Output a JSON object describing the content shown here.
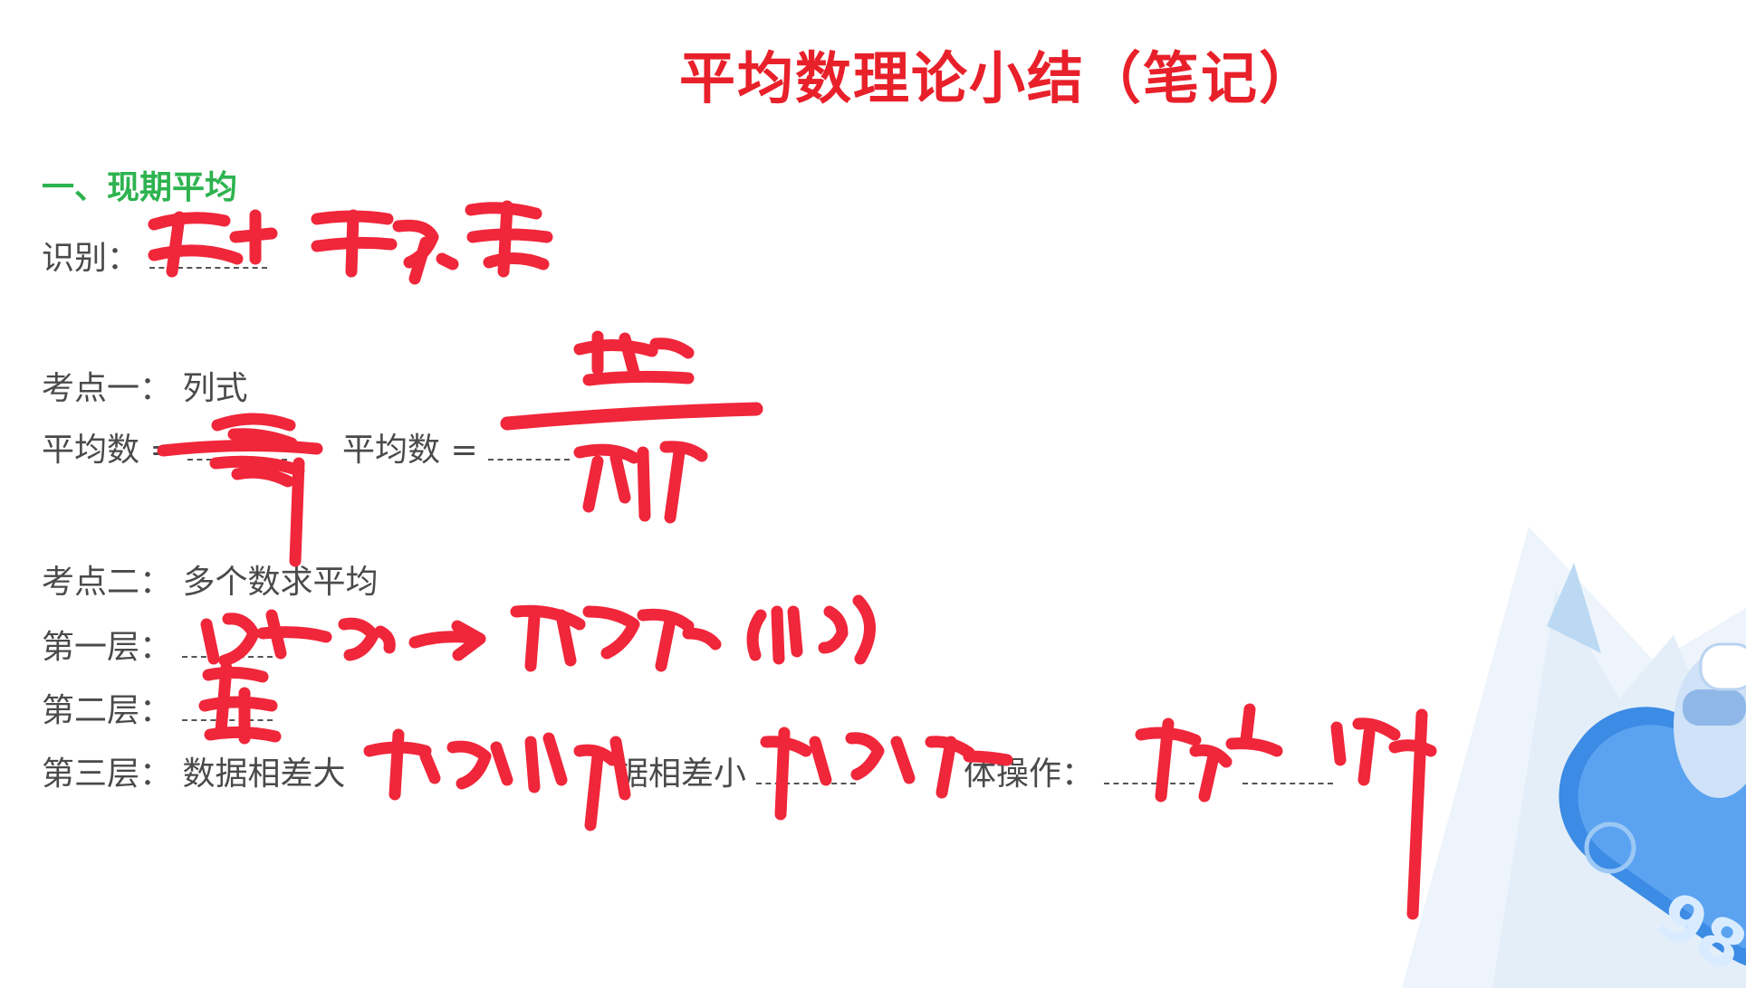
{
  "title": "平均数理论小结（笔记）",
  "section1": "一、现期平均",
  "identify_label": "识别：",
  "point1": "考点一：  列式",
  "avg_label_1": "平均数 =",
  "avg_label_2": "平均数 =",
  "point2": "考点二：  多个数求平均",
  "layer1_label": "第一层：",
  "layer2_label": "第二层：",
  "layer3_label": "第三层：  数据相差大",
  "layer3_mid": "据相差小",
  "layer3_end": "体操作：",
  "colors": {
    "title": "#e8202a",
    "section": "#2db34f",
    "ink": "#f0263a",
    "text": "#4a4a4a"
  },
  "decoration": {
    "badge_text": "98"
  }
}
